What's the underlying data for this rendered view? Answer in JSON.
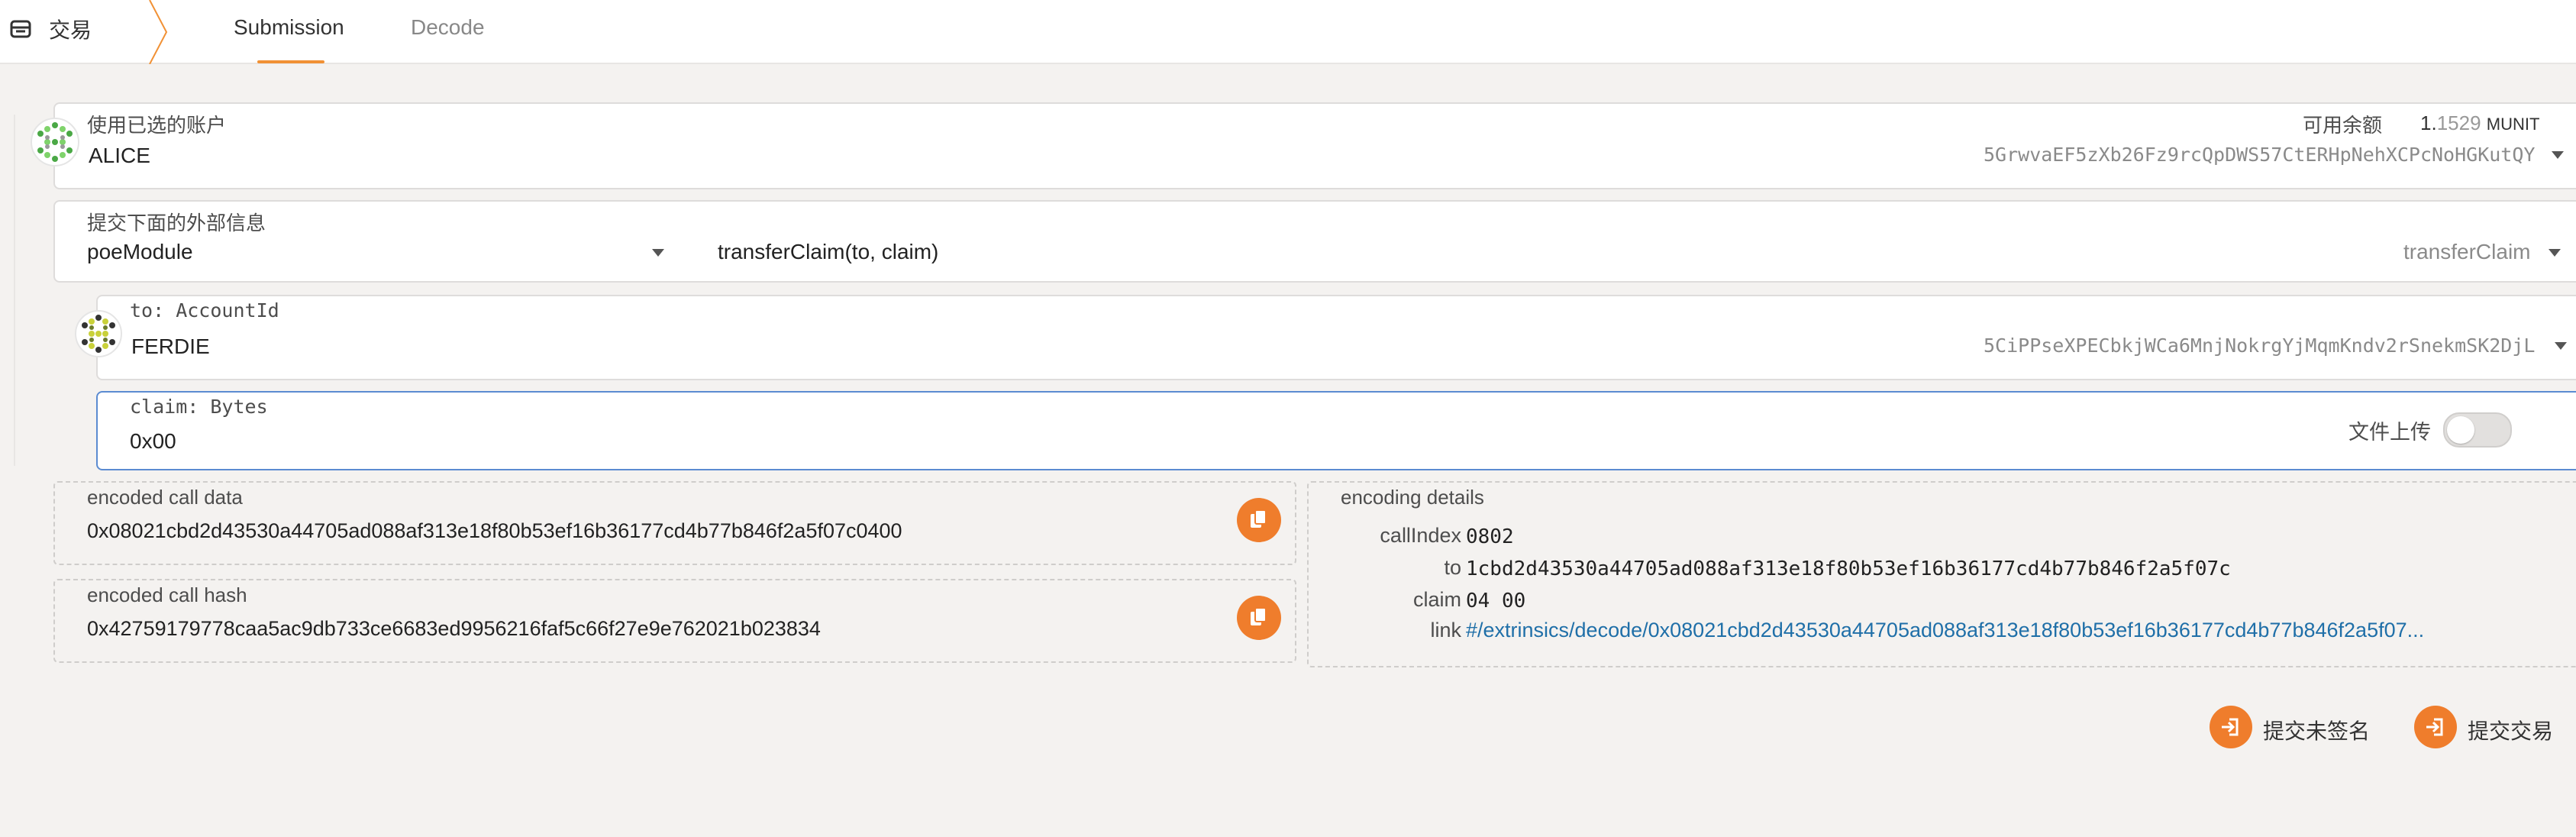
{
  "header": {
    "title": "交易",
    "tabs": [
      {
        "label": "Submission",
        "active": true
      },
      {
        "label": "Decode",
        "active": false
      }
    ],
    "accent_color": "#f19135"
  },
  "account": {
    "label": "使用已选的账户",
    "name": "ALICE",
    "address": "5GrwvaEF5zXb26Fz9rcQpDWS57CtERHpNehXCPcNoHGKutQY",
    "balance_label": "可用余额",
    "balance_int": "1.",
    "balance_dec": "1529",
    "balance_unit": "MUNIT"
  },
  "extrinsic": {
    "label": "提交下面的外部信息",
    "module": "poeModule",
    "method_signature": "transferClaim(to, claim)",
    "method": "transferClaim"
  },
  "params": {
    "to": {
      "label": "to: AccountId",
      "name": "FERDIE",
      "address": "5CiPPseXPECbkjWCa6MnjNokrgYjMqmKndv2rSnekmSK2DjL"
    },
    "claim": {
      "label": "claim: Bytes",
      "value": "0x00",
      "file_upload_label": "文件上传"
    }
  },
  "encoded": {
    "call_data_label": "encoded call data",
    "call_data": "0x08021cbd2d43530a44705ad088af313e18f80b53ef16b36177cd4b77b846f2a5f07c0400",
    "call_hash_label": "encoded call hash",
    "call_hash": "0x42759179778caa5ac9db733ce6683ed9956216faf5c66f27e9e762021b023834"
  },
  "encoding_details": {
    "label": "encoding details",
    "rows": [
      {
        "key": "callIndex",
        "value": "0802"
      },
      {
        "key": "to",
        "value": "1cbd2d43530a44705ad088af313e18f80b53ef16b36177cd4b77b846f2a5f07c"
      },
      {
        "key": "claim",
        "value": "04 00"
      },
      {
        "key": "link",
        "value": "#/extrinsics/decode/0x08021cbd2d43530a44705ad088af313e18f80b53ef16b36177cd4b77b846f2a5f07..."
      }
    ]
  },
  "actions": {
    "submit_unsigned": "提交未签名",
    "submit_transaction": "提交交易"
  }
}
